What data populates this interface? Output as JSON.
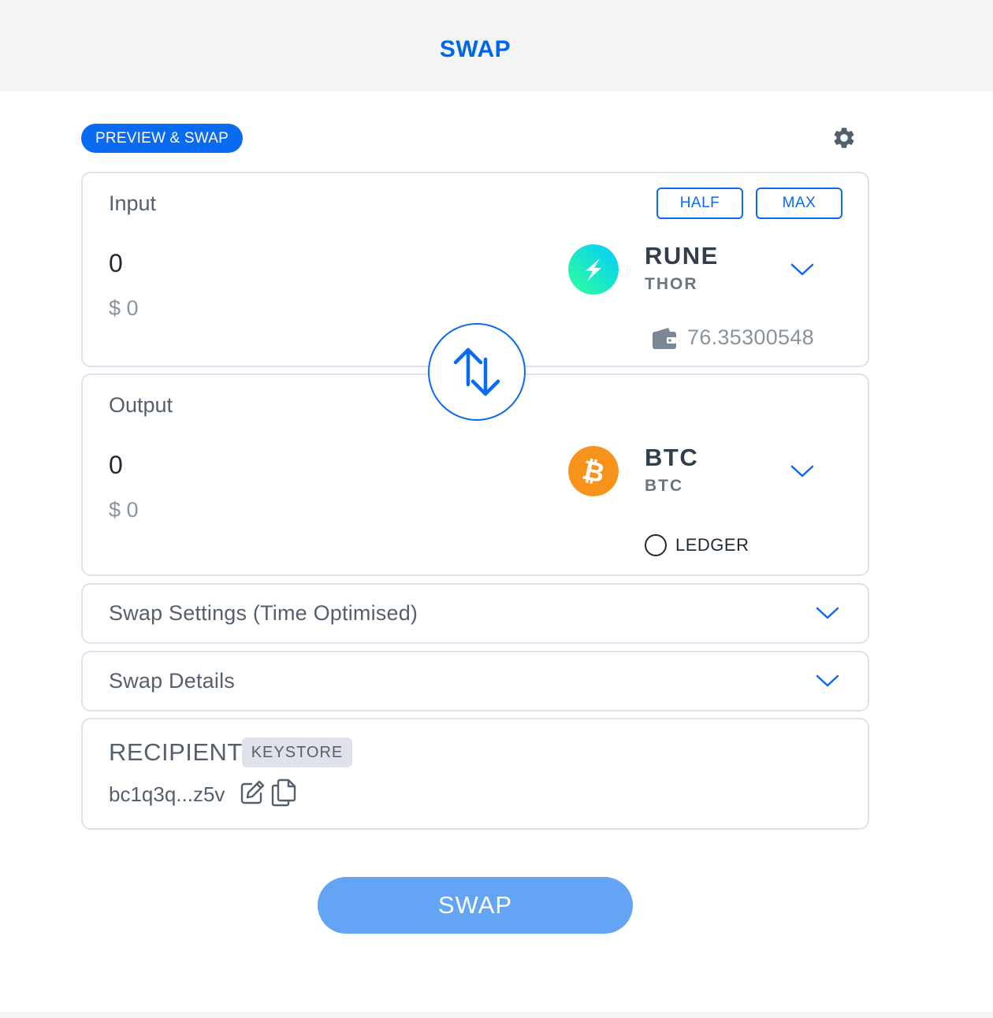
{
  "header": {
    "tab_label": "SWAP"
  },
  "toolbar": {
    "preview_label": "PREVIEW & SWAP",
    "settings_icon": "gear-icon"
  },
  "input": {
    "label": "Input",
    "amount": "0",
    "usd": "$ 0",
    "half_label": "HALF",
    "max_label": "MAX",
    "token": {
      "ticker": "RUNE",
      "chain": "THOR",
      "color": "#23dcc8"
    },
    "balance": "76.35300548"
  },
  "output": {
    "label": "Output",
    "amount": "0",
    "usd": "$ 0",
    "token": {
      "ticker": "BTC",
      "chain": "BTC",
      "color": "#f7931a"
    },
    "ledger_label": "LEDGER"
  },
  "swap_settings": {
    "label": "Swap Settings (Time Optimised)"
  },
  "swap_details": {
    "label": "Swap Details"
  },
  "recipient": {
    "title": "RECIPIENT",
    "badge": "KEYSTORE",
    "address": "bc1q3q...z5v"
  },
  "swap_button": {
    "label": "SWAP"
  },
  "colors": {
    "accent": "#0a6bf0",
    "swap_button": "#63a4f5",
    "header_bg": "#f3f4f4"
  }
}
